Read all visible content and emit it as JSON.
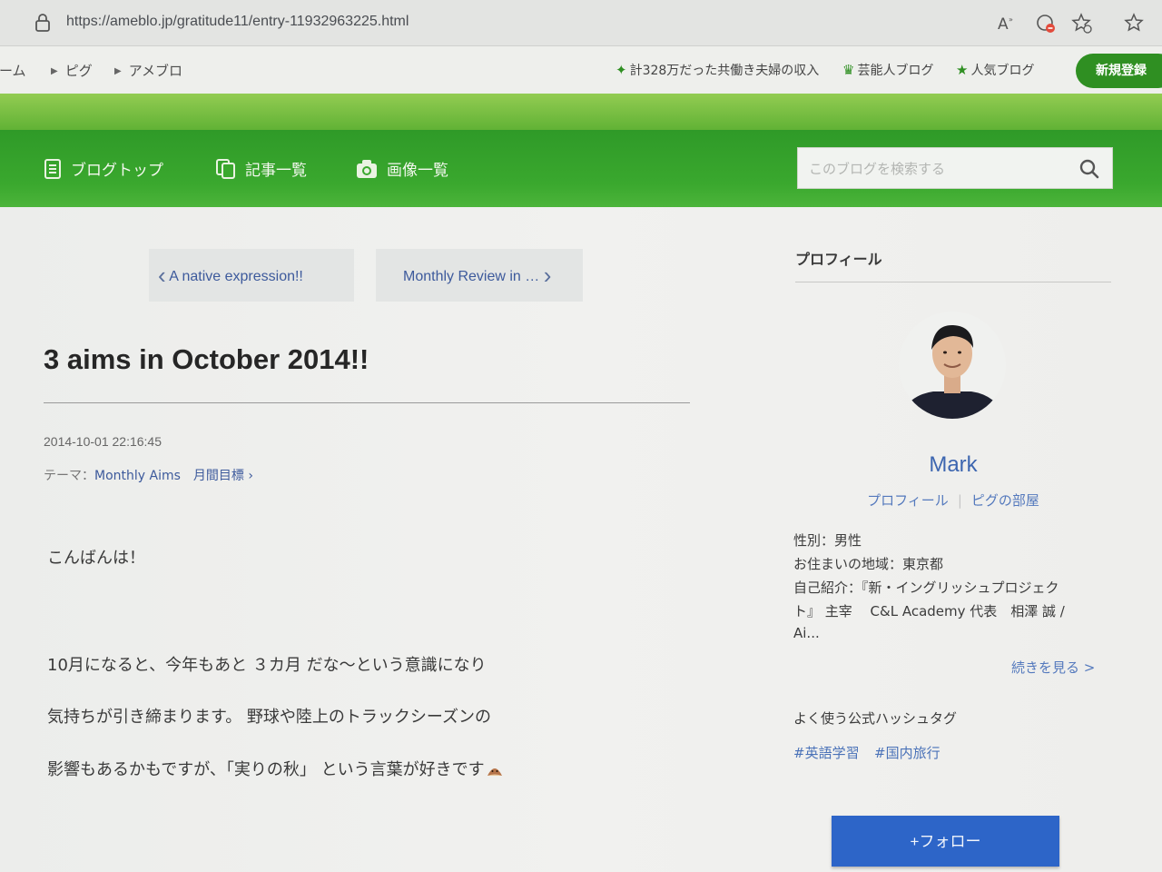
{
  "browser": {
    "url": "https://ameblo.jp/gratitude11/entry-11932963225.html"
  },
  "top_nav": {
    "crumbs": [
      "ホーム",
      "ピグ",
      "アメブロ"
    ],
    "promos": [
      {
        "icon": "sparkle-icon",
        "label": "計328万だった共働き夫婦の収入"
      },
      {
        "icon": "crown-icon",
        "label": "芸能人ブログ"
      },
      {
        "icon": "star-icon",
        "label": "人気ブログ"
      }
    ],
    "signup_label": "新規登録"
  },
  "blog_nav": {
    "items": [
      "ブログトップ",
      "記事一覧",
      "画像一覧"
    ],
    "search_placeholder": "このブログを検索する"
  },
  "post": {
    "prev_label": "A native expression!!",
    "next_label": "Monthly Review in …",
    "title": "3 aims in October 2014!!",
    "date": "2014-10-01 22:16:45",
    "theme_label": "テーマ：",
    "theme_value": "Monthly Aims　月間目標",
    "body_lines": [
      "こんばんは！",
      "10月になると、今年もあと ３カ月 だな～という意識になり",
      "気持ちが引き締まります。 野球や陸上のトラックシーズンの",
      "影響もあるかもですが、「実りの秋」 という言葉が好きです"
    ]
  },
  "sidebar": {
    "heading": "プロフィール",
    "name": "Mark",
    "links": [
      "プロフィール",
      "ピグの部屋"
    ],
    "info": [
      "性別：男性",
      "お住まいの地域：東京都",
      "自己紹介：『新・イングリッシュプロジェク",
      "ト』 主宰　 C&L Academy 代表　相澤 誠 /",
      "Ai..."
    ],
    "more_label": "続きを見る >",
    "hashtag_heading": "よく使う公式ハッシュタグ",
    "hashtags": [
      "#英語学習",
      "#国内旅行"
    ],
    "follow_label": "+フォロー"
  },
  "colors": {
    "header_green": "#3aa82e",
    "link_blue": "#3d5a9c",
    "follow_blue": "#2d65c8"
  }
}
